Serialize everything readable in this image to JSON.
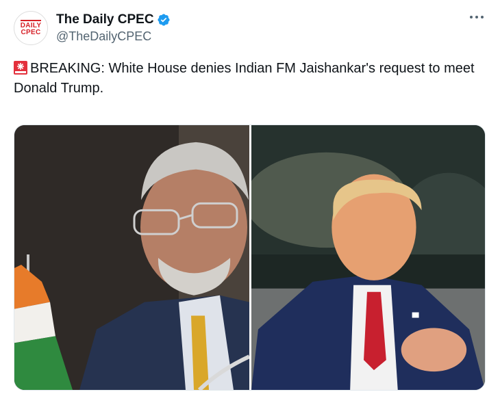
{
  "account": {
    "display_name": "The Daily CPEC",
    "handle": "@TheDailyCPEC",
    "avatar_text_line1": "DAILY",
    "avatar_text_line2": "CPEC",
    "verified": true,
    "avatar_icon": "daily-cpec-logo"
  },
  "post": {
    "text": "BREAKING: White House denies Indian FM Jaishankar's request to meet Donald Trump.",
    "leading_emoji": "siren-icon"
  },
  "media": {
    "images": [
      {
        "subject": "man-in-suit-with-glasses-photo"
      },
      {
        "subject": "man-in-suit-with-red-tie-photo"
      }
    ]
  },
  "colors": {
    "verified_badge": "#1d9bf0",
    "text_primary": "#0f1419",
    "text_secondary": "#536471",
    "brand_red": "#d61f26"
  }
}
